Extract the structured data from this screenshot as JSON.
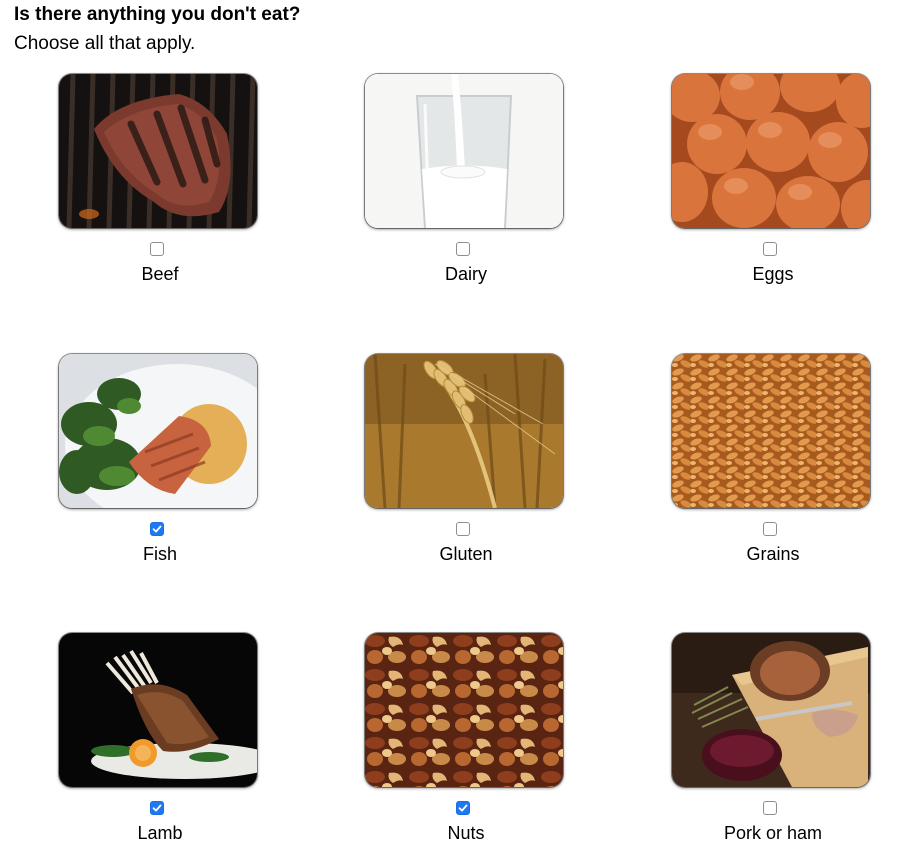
{
  "question": {
    "title": "Is there anything you don't eat?",
    "subtitle": "Choose all that apply."
  },
  "options": [
    {
      "label": "Beef",
      "checked": false,
      "image": "beef-steak-photo"
    },
    {
      "label": "Dairy",
      "checked": false,
      "image": "milk-glass-photo"
    },
    {
      "label": "Eggs",
      "checked": false,
      "image": "brown-eggs-photo"
    },
    {
      "label": "Fish",
      "checked": true,
      "image": "salmon-plate-photo"
    },
    {
      "label": "Gluten",
      "checked": false,
      "image": "wheat-field-photo"
    },
    {
      "label": "Grains",
      "checked": false,
      "image": "oat-grains-photo"
    },
    {
      "label": "Lamb",
      "checked": true,
      "image": "lamb-rack-photo"
    },
    {
      "label": "Nuts",
      "checked": true,
      "image": "mixed-nuts-photo"
    },
    {
      "label": "Pork or ham",
      "checked": false,
      "image": "roast-pork-photo"
    }
  ],
  "colors": {
    "checkbox_checked": "#1e78f0",
    "checkbox_border": "#8e8e8e"
  }
}
